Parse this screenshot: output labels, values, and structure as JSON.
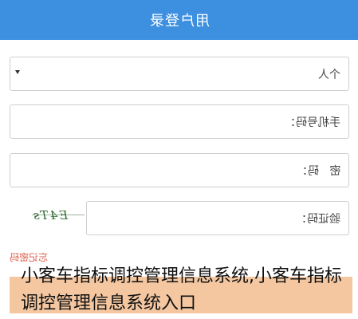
{
  "header": {
    "title": "用户登录"
  },
  "form": {
    "account_type": "个人",
    "phone_label": "手机号码：",
    "password_label": "密   码：",
    "captcha_label": "验证码：",
    "captcha_text": "E4Ts",
    "retrieve_link": "忘记密码"
  },
  "overlay": {
    "caption": "小客车指标调控管理信息系统,小客车指标调控管理信息系统入口"
  },
  "colors": {
    "header_bg": "#3d8fe0",
    "link": "#e05a4a",
    "watermark": "#f0b482"
  }
}
